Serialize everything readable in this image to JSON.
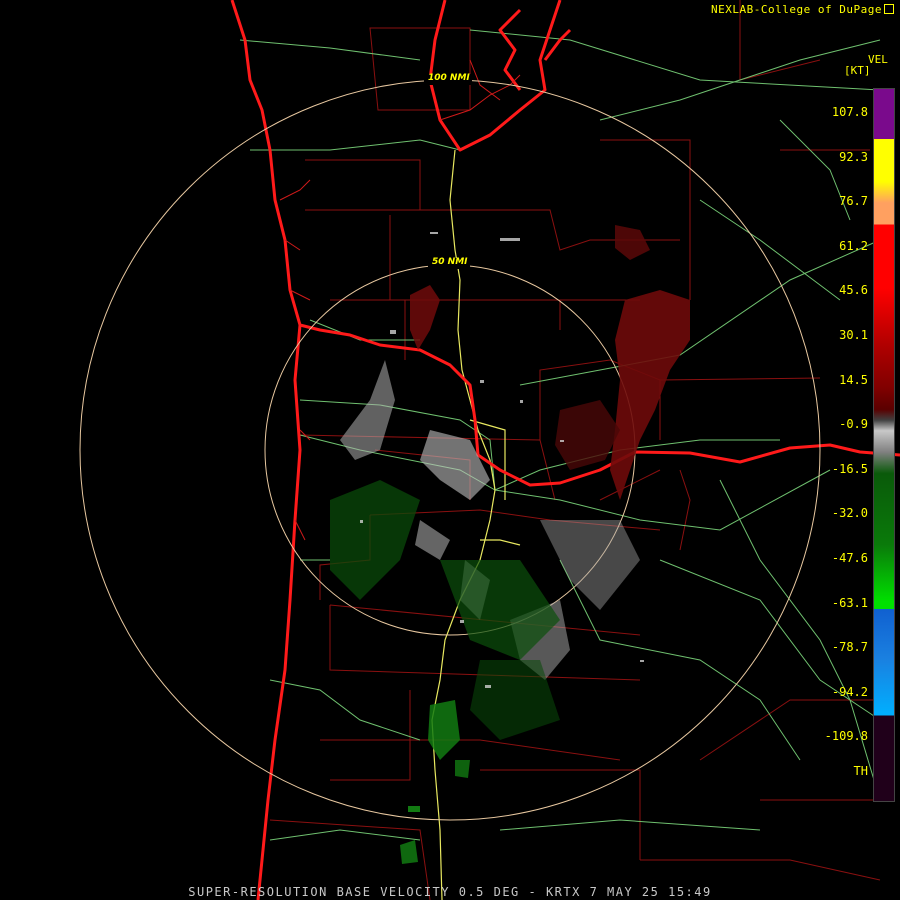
{
  "credit": "NEXLAB-College of DuPage",
  "legend": {
    "product": "VEL",
    "units": "[KT]",
    "ticks": [
      "107.8",
      "92.3",
      "76.7",
      "61.2",
      "45.6",
      "30.1",
      "14.5",
      "-0.9",
      "-16.5",
      "-32.0",
      "-47.6",
      "-63.1",
      "-78.7",
      "-94.2",
      "-109.8",
      "TH"
    ],
    "colors": {
      "purple": "#7a0a8c",
      "yellow": "#ffff00",
      "orange": "#ffa060",
      "red": "#ff0000",
      "dark_red": "#5a0000",
      "gray": "#c8c8c8",
      "dark_green": "#0a5a0a",
      "green": "#00e000",
      "blue": "#1060d0",
      "cyan": "#00b0ff",
      "dark_purple": "#20001a"
    }
  },
  "rings": {
    "inner_label": "50 NMI",
    "outer_label": "100 NMI"
  },
  "footer": "SUPER-RESOLUTION BASE VELOCITY 0.5 DEG - KRTX 7 MAY 25 15:49"
}
